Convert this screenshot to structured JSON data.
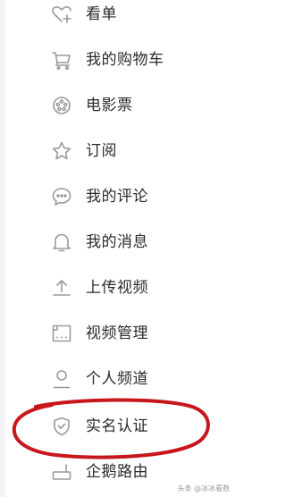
{
  "menu": {
    "items": [
      {
        "label": "看单",
        "icon": "heart-plus-icon"
      },
      {
        "label": "我的购物车",
        "icon": "cart-icon"
      },
      {
        "label": "电影票",
        "icon": "film-reel-icon"
      },
      {
        "label": "订阅",
        "icon": "star-icon"
      },
      {
        "label": "我的评论",
        "icon": "comment-icon"
      },
      {
        "label": "我的消息",
        "icon": "bell-icon"
      },
      {
        "label": "上传视频",
        "icon": "upload-icon"
      },
      {
        "label": "视频管理",
        "icon": "video-manage-icon"
      },
      {
        "label": "个人频道",
        "icon": "person-icon"
      },
      {
        "label": "实名认证",
        "icon": "shield-check-icon"
      },
      {
        "label": "企鹅路由",
        "icon": "router-icon"
      }
    ]
  },
  "annotation": {
    "shape": "hand-drawn ellipse around the verification item",
    "color": "#c8161d"
  },
  "watermark": {
    "text": "头条 @冰冰看数"
  },
  "colors": {
    "text": "#2b2b2b",
    "icon": "#9a9a9a",
    "background": "#ffffff",
    "annotation": "#c8161d"
  }
}
